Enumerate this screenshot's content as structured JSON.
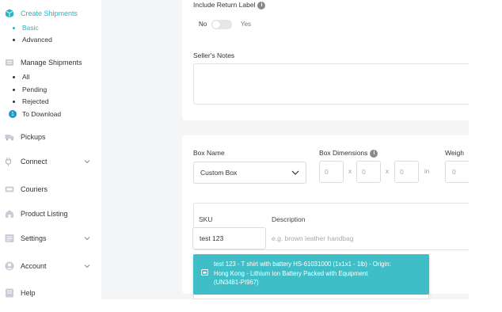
{
  "sidebar": {
    "create_shipments": "Create Shipments",
    "create_sub": [
      "Basic",
      "Advanced"
    ],
    "manage_shipments": "Manage Shipments",
    "manage_sub": [
      "All",
      "Pending",
      "Rejected"
    ],
    "to_download": "To Download",
    "to_download_badge": "1",
    "pickups": "Pickups",
    "connect": "Connect",
    "couriers": "Couriers",
    "product_listing": "Product Listing",
    "settings": "Settings",
    "account": "Account",
    "help": "Help"
  },
  "return_label": {
    "label": "Include Return Label",
    "no": "No",
    "yes": "Yes",
    "info_icon": "i"
  },
  "sellers_notes": {
    "label": "Seller's Notes",
    "value": ""
  },
  "box": {
    "name_label": "Box Name",
    "name_value": "Custom Box",
    "dimensions_label": "Box Dimensions",
    "dim_values": [
      "0",
      "0",
      "0"
    ],
    "mul": "x",
    "unit": "in",
    "weight_label": "Weigh",
    "weight_value": "0",
    "info_icon": "i"
  },
  "item": {
    "sku_label": "SKU",
    "sku_value": "test 123",
    "description_label": "Description",
    "description_placeholder": "e.g. brown leather handbag"
  },
  "suggestion": {
    "line1": "test 123 - T shirt with battery HS-61031000 (1x1x1 - 1lb) - Origin:",
    "line2": "Hong Kong - Lithium Ion Battery Packed with Equipment",
    "line3": "(UN3481-PI967)"
  },
  "colors": {
    "accent": "#29b6c3",
    "suggestion_bg": "#3fbec8",
    "main_bg": "#f4f5f7"
  }
}
